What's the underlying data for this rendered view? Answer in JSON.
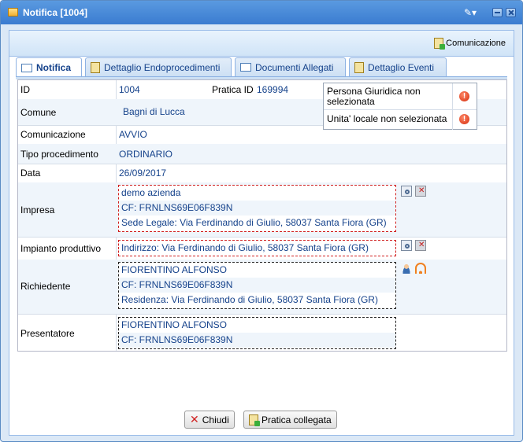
{
  "window": {
    "title": "Notifica [1004]"
  },
  "toolbar": {
    "comunicazione_label": "Comunicazione"
  },
  "tabs": [
    {
      "label": "Notifica",
      "active": true
    },
    {
      "label": "Dettaglio Endoprocedimenti"
    },
    {
      "label": "Documenti Allegati"
    },
    {
      "label": "Dettaglio Eventi"
    }
  ],
  "form": {
    "id_label": "ID",
    "id_value": "1004",
    "pratica_label": "Pratica ID",
    "pratica_value": "169994",
    "comune_label": "Comune",
    "comune_value": "Bagni di Lucca",
    "comunicazione_label": "Comunicazione",
    "comunicazione_value": "AVVIO",
    "tipo_label": "Tipo procedimento",
    "tipo_value": "ORDINARIO",
    "data_label": "Data",
    "data_value": "26/09/2017",
    "impresa_label": "Impresa",
    "impresa_lines": [
      "demo azienda",
      "CF: FRNLNS69E06F839N",
      "Sede Legale: Via Ferdinando di Giulio, 58037 Santa Fiora (GR)"
    ],
    "impianto_label": "Impianto produttivo",
    "impianto_lines": [
      "Indirizzo: Via Ferdinando di Giulio, 58037 Santa Fiora (GR)"
    ],
    "richiedente_label": "Richiedente",
    "richiedente_lines": [
      "FIORENTINO ALFONSO",
      "CF: FRNLNS69E06F839N",
      "Residenza: Via Ferdinando di Giulio, 58037 Santa Fiora (GR)"
    ],
    "presentatore_label": "Presentatore",
    "presentatore_lines": [
      "FIORENTINO ALFONSO",
      "CF: FRNLNS69E06F839N"
    ]
  },
  "warnings": [
    {
      "text": "Persona Giuridica non selezionata",
      "icon": "warning-icon"
    },
    {
      "text": "Unita' locale non selezionata",
      "icon": "warning-icon"
    }
  ],
  "buttons": {
    "chiudi": "Chiudi",
    "pratica_collegata": "Pratica collegata"
  },
  "colors": {
    "titlebar": "#3a7bd0",
    "link": "#15428b",
    "error_border": "#d02020"
  }
}
